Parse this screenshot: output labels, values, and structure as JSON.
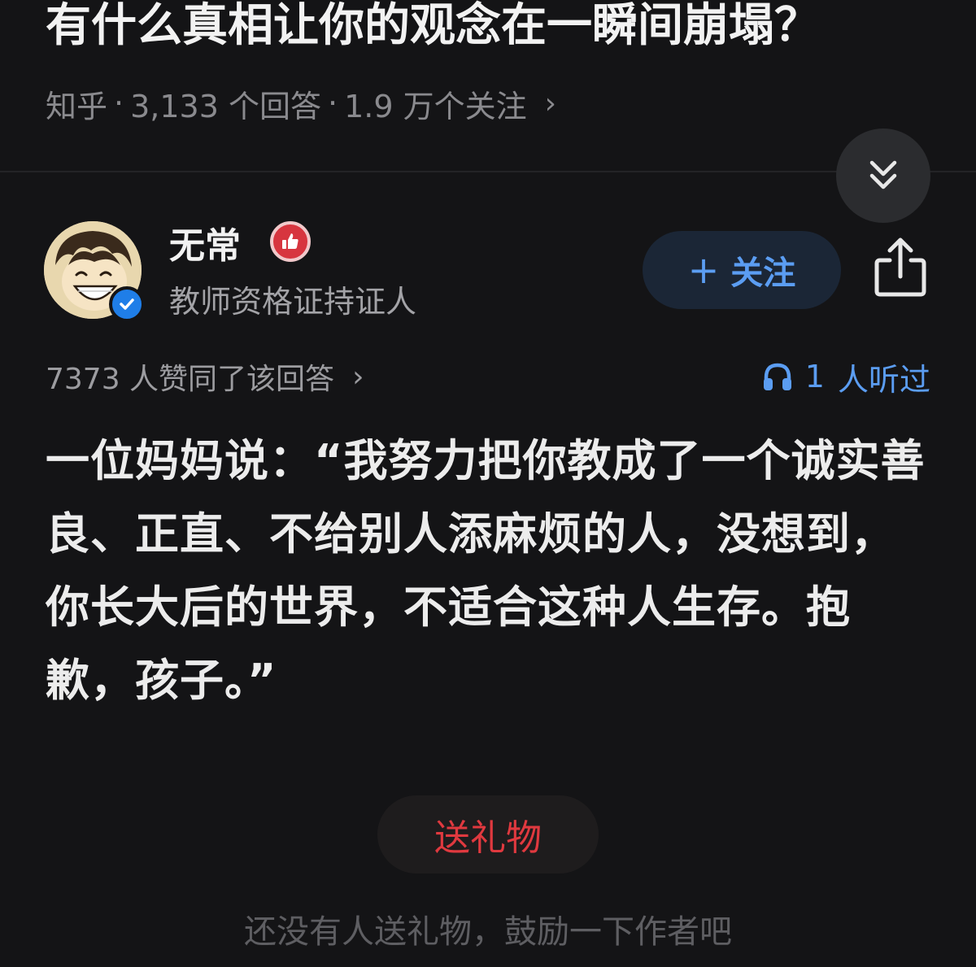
{
  "question": {
    "title": "有什么真相让你的观念在一瞬间崩塌？",
    "source": "知乎",
    "answer_count": "3,133 个回答",
    "follow_count": "1.9 万个关注",
    "separator": "·"
  },
  "author": {
    "name": "无常",
    "bio": "教师资格证持证人",
    "follow_label": "关注"
  },
  "stats": {
    "upvote_text": "7373 人赞同了该回答",
    "listen_count": "1",
    "listen_suffix": "人听过"
  },
  "answer": {
    "text": "一位妈妈说：“我努力把你教成了一个诚实善良、正直、不给别人添麻烦的人，没想到，你长大后的世界，不适合这种人生存。抱歉，孩子。”"
  },
  "gift": {
    "button_label": "送礼物",
    "hint": "还没有人送礼物，鼓励一下作者吧"
  },
  "icons": {
    "collapse": "double-chevron-down-icon",
    "verified": "verified-check-icon",
    "badge": "thumbs-up-badge-icon",
    "share": "share-icon",
    "listen": "headphones-icon"
  },
  "colors": {
    "background": "#141416",
    "accent_blue": "#5b9df2",
    "gift_red": "#e0393f"
  }
}
